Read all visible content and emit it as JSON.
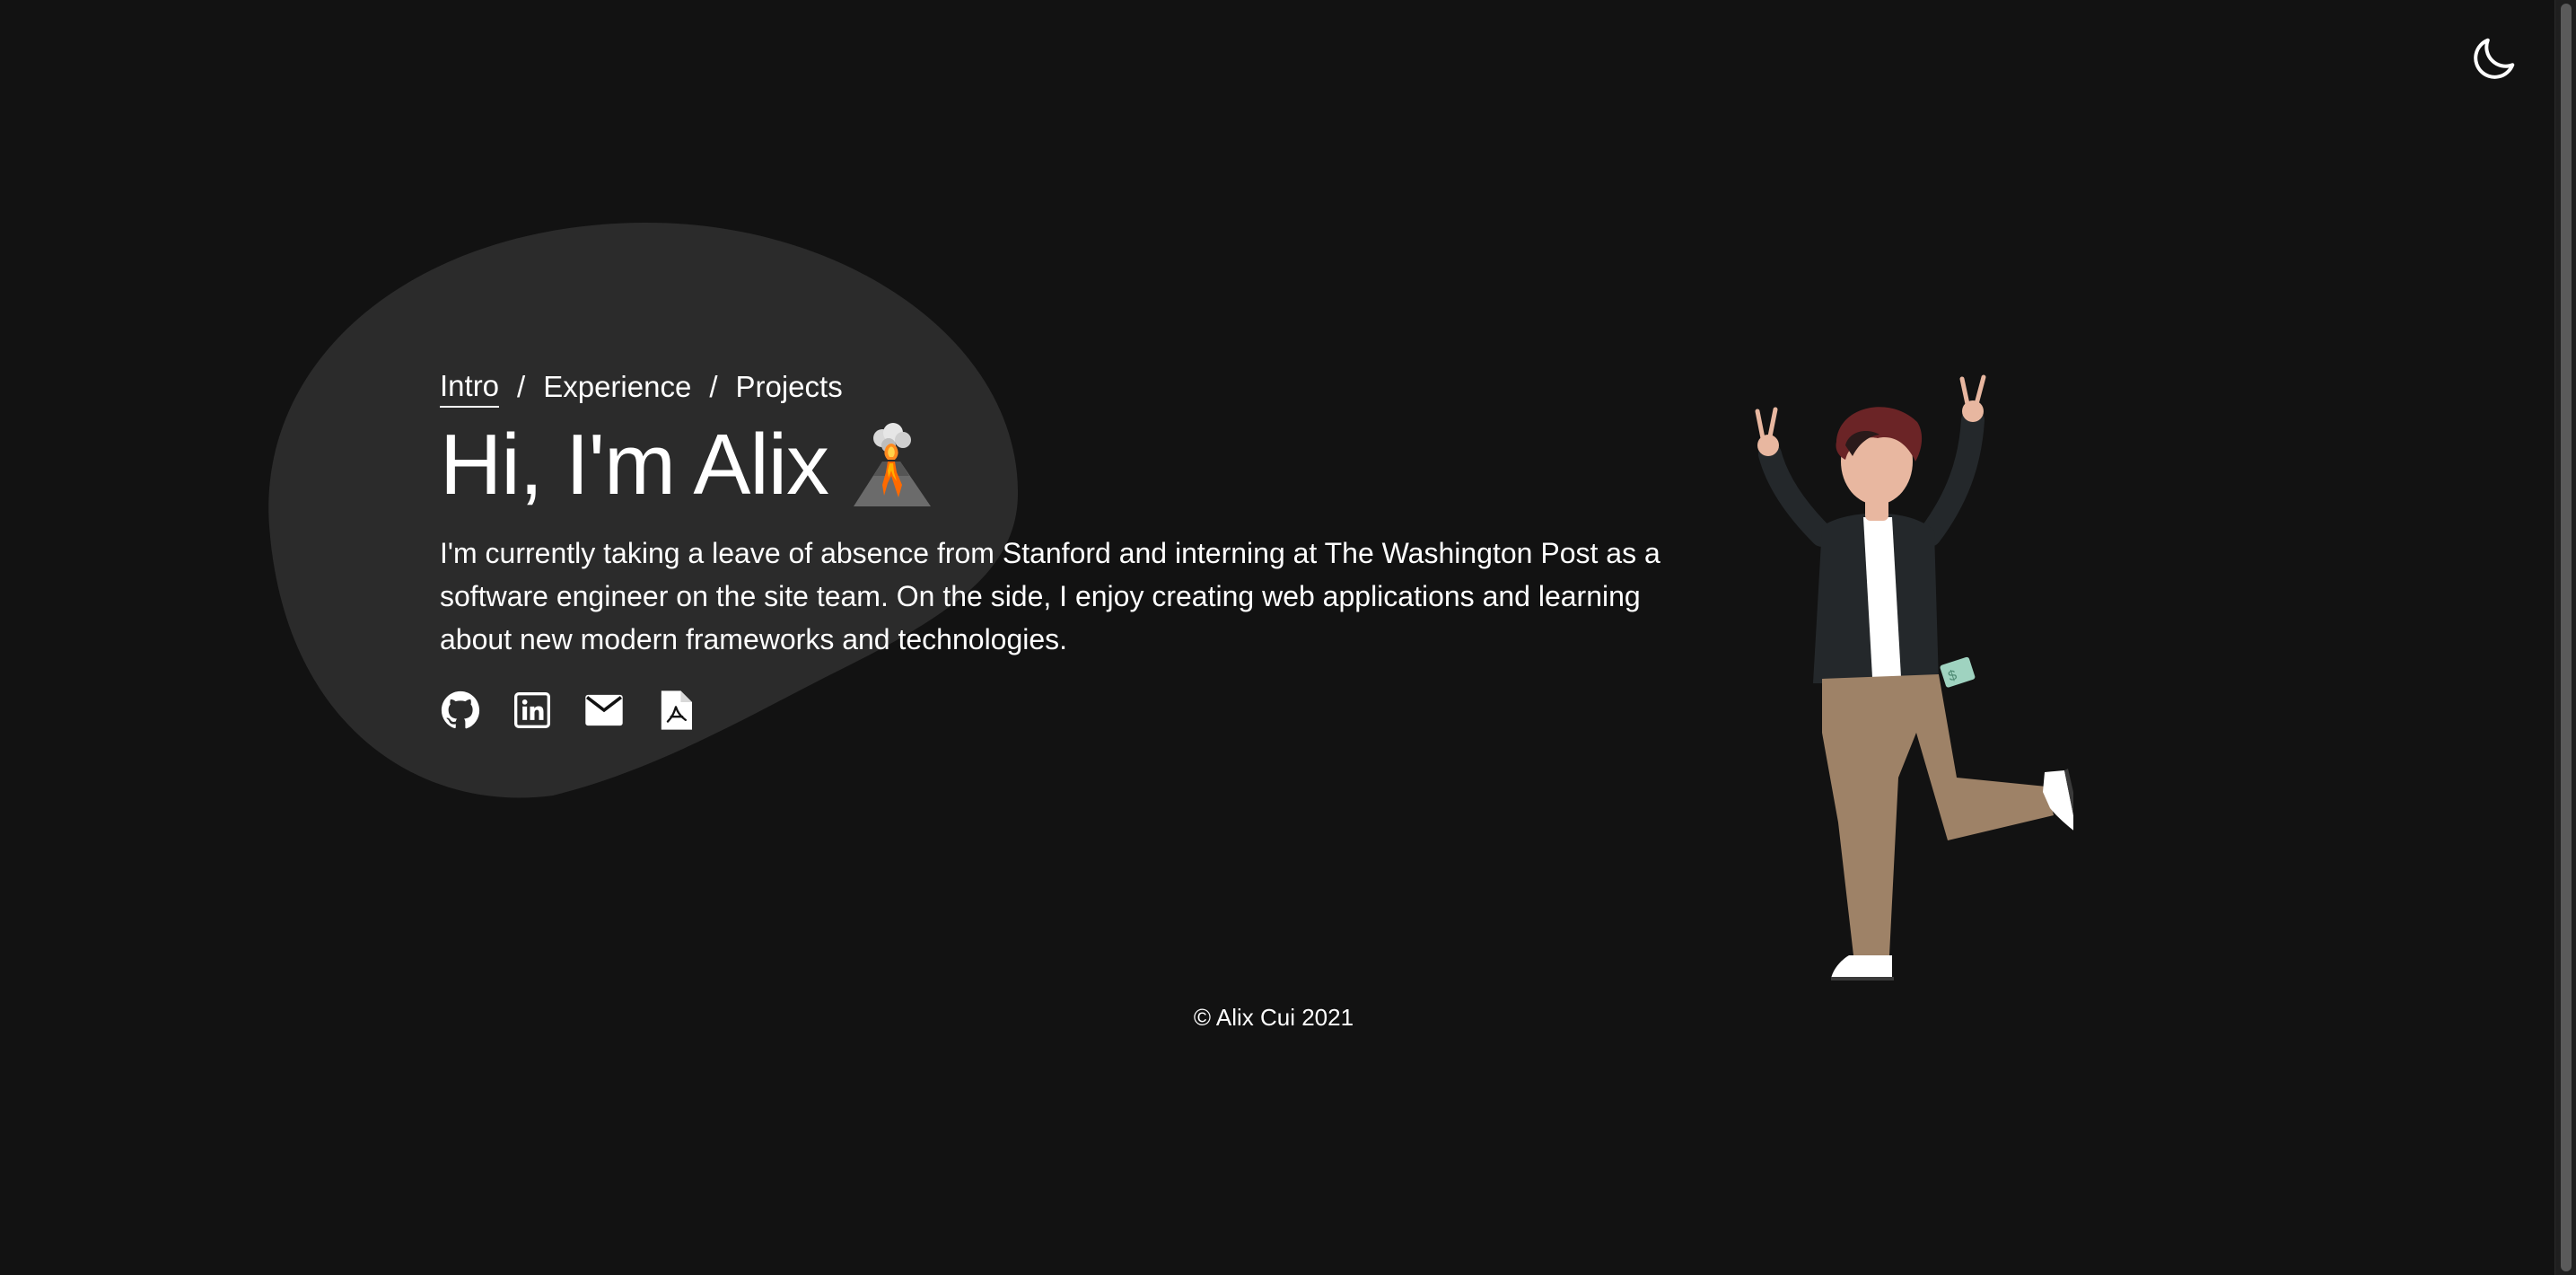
{
  "theme_toggle": {
    "icon": "moon-icon"
  },
  "nav": {
    "items": [
      {
        "label": "Intro",
        "active": true
      },
      {
        "label": "Experience",
        "active": false
      },
      {
        "label": "Projects",
        "active": false
      }
    ],
    "separator": "/"
  },
  "hero": {
    "title": "Hi, I'm Alix",
    "emoji_icon": "volcano-icon",
    "bio": "I'm currently taking a leave of absence from Stanford and interning at The Washington Post as a software engineer on the site team. On the side, I enjoy creating web applications and learning about new modern frameworks and technologies."
  },
  "socials": [
    {
      "icon": "github-icon"
    },
    {
      "icon": "linkedin-icon"
    },
    {
      "icon": "email-icon"
    },
    {
      "icon": "pdf-resume-icon"
    }
  ],
  "illustration": {
    "icon": "celebrating-person-illustration"
  },
  "footer": {
    "text": "© Alix Cui 2021"
  },
  "colors": {
    "background": "#121212",
    "blob": "#2b2b2b",
    "text": "#ffffff"
  }
}
